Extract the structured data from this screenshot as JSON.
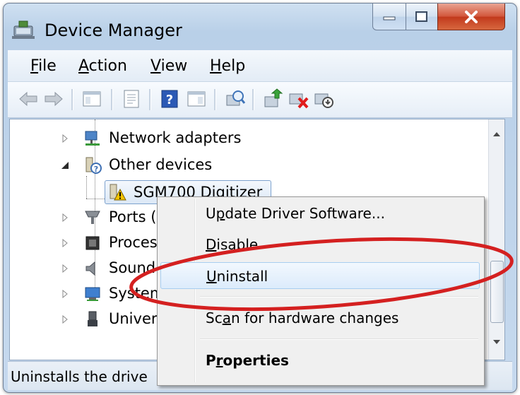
{
  "window": {
    "title": "Device Manager"
  },
  "menubar": {
    "items": [
      "File",
      "Action",
      "View",
      "Help"
    ]
  },
  "toolbar": {
    "icons": [
      "back-arrow-icon",
      "forward-arrow-icon",
      "show-hide-console-tree-icon",
      "properties-icon",
      "help-icon",
      "action-pane-icon",
      "scan-hardware-icon",
      "update-driver-icon",
      "uninstall-device-icon",
      "disable-device-icon"
    ]
  },
  "tree": {
    "nodes": [
      {
        "label": "Network adapters",
        "icon": "network-adapter-icon"
      },
      {
        "label": "Other devices",
        "icon": "unknown-device-icon"
      },
      {
        "label": "SGM700 Digitizer",
        "icon": "warning-device-icon"
      },
      {
        "label": "Ports (",
        "icon": "ports-icon"
      },
      {
        "label": "Proces",
        "icon": "processor-icon"
      },
      {
        "label": "Sound",
        "icon": "sound-icon"
      },
      {
        "label": "System",
        "icon": "system-icon"
      },
      {
        "label": "Univer",
        "icon": "usb-icon"
      }
    ]
  },
  "context_menu": {
    "items": [
      {
        "pre": "U",
        "accel": "p",
        "post": "date Driver Software..."
      },
      {
        "pre": "",
        "accel": "D",
        "post": "isable"
      },
      {
        "pre": "",
        "accel": "U",
        "post": "ninstall"
      },
      {
        "pre": "Sc",
        "accel": "a",
        "post": "n for hardware changes"
      },
      {
        "pre": "P",
        "accel": "r",
        "post": "operties"
      }
    ]
  },
  "status": {
    "text": "Uninstalls the drive"
  },
  "colors": {
    "highlight_ellipse": "#d42020",
    "selection_border": "#7da2ce",
    "close_button": "#c8452a"
  }
}
